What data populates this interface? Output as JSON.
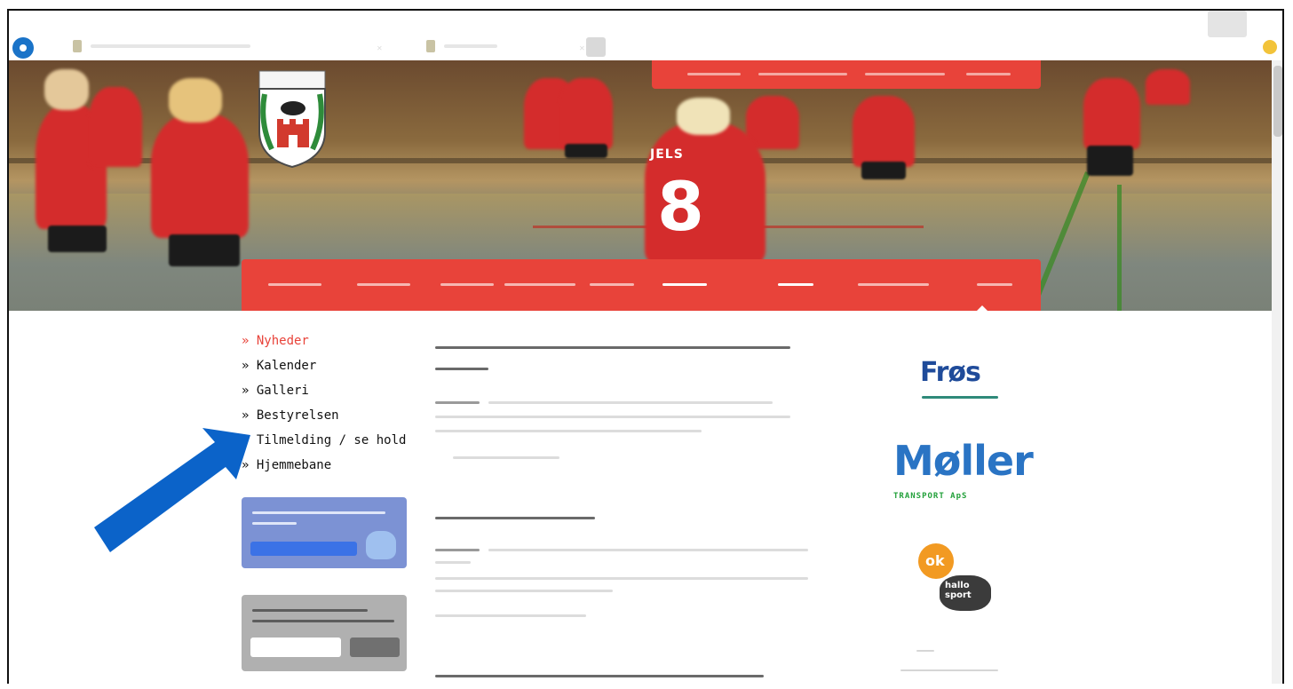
{
  "sidebar_menu": {
    "items": [
      {
        "label": "» Nyheder",
        "active": true
      },
      {
        "label": "» Kalender",
        "active": false
      },
      {
        "label": "» Galleri",
        "active": false
      },
      {
        "label": "» Bestyrelsen",
        "active": false
      },
      {
        "label": "» Tilmelding / se hold",
        "active": false
      },
      {
        "label": "» Hjemmebane",
        "active": false
      }
    ]
  },
  "hero": {
    "jersey_name": "JELS",
    "jersey_number": "8"
  },
  "sponsors": {
    "fros": "Frøs",
    "moller": "Møller",
    "moller_sub": "TRANSPORT ApS",
    "ok": "ok",
    "ok_sub": "hallo\nsport"
  },
  "colors": {
    "accent": "#e8433a",
    "facebook_box": "#7c92d4",
    "newsletter_box": "#b0b0b0",
    "annotation_arrow": "#0b63c9"
  },
  "icons": {
    "crest": "club-crest-icon",
    "thumb": "thumbs-up-icon",
    "arrow": "annotation-arrow-icon"
  }
}
